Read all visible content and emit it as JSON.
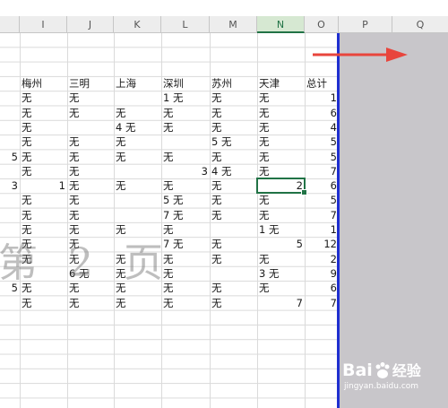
{
  "columns": [
    {
      "label": "I",
      "selected": false
    },
    {
      "label": "J",
      "selected": false
    },
    {
      "label": "K",
      "selected": false
    },
    {
      "label": "L",
      "selected": false
    },
    {
      "label": "M",
      "selected": false
    },
    {
      "label": "N",
      "selected": true
    },
    {
      "label": "O",
      "selected": false
    },
    {
      "label": "P",
      "selected": false
    },
    {
      "label": "Q",
      "selected": false
    }
  ],
  "headers": [
    "梅州",
    "三明",
    "上海",
    "深圳",
    "苏州",
    "天津",
    "总计"
  ],
  "rows": [
    {
      "lead": "",
      "cells": [
        "无",
        "无",
        "",
        "1 无",
        "无",
        "无",
        "1"
      ]
    },
    {
      "lead": "",
      "cells": [
        "无",
        "无",
        "无",
        "无",
        "无",
        "无",
        "6"
      ]
    },
    {
      "lead": "",
      "cells": [
        "无",
        "",
        "4 无",
        "无",
        "无",
        "无",
        "4"
      ]
    },
    {
      "lead": "",
      "cells": [
        "无",
        "无",
        "无",
        "",
        "5 无",
        "无",
        "5"
      ]
    },
    {
      "lead": "5",
      "cells": [
        "无",
        "无",
        "无",
        "无",
        "无",
        "无",
        "5"
      ]
    },
    {
      "lead": "",
      "cells": [
        "无",
        "无",
        "",
        "3",
        "4 无",
        "无",
        "7"
      ]
    },
    {
      "lead": "3",
      "cells": [
        "1",
        "无",
        "无",
        "无",
        "无",
        "2",
        "6"
      ]
    },
    {
      "lead": "",
      "cells": [
        "无",
        "无",
        "",
        "5 无",
        "无",
        "无",
        "5"
      ]
    },
    {
      "lead": "",
      "cells": [
        "无",
        "无",
        "",
        "7 无",
        "无",
        "无",
        "7"
      ]
    },
    {
      "lead": "",
      "cells": [
        "无",
        "无",
        "无",
        "无",
        "",
        "1 无",
        "1"
      ]
    },
    {
      "lead": "",
      "cells": [
        "无",
        "无",
        "",
        "7 无",
        "无",
        "5",
        "12"
      ]
    },
    {
      "lead": "",
      "cells": [
        "无",
        "无",
        "无",
        "无",
        "无",
        "无",
        "2"
      ]
    },
    {
      "lead": "",
      "cells": [
        "",
        "6 无",
        "无",
        "无",
        "",
        "3 无",
        "9"
      ]
    },
    {
      "lead": "5",
      "cells": [
        "无",
        "无",
        "无",
        "无",
        "无",
        "无",
        "6"
      ]
    },
    {
      "lead": "",
      "cells": [
        "无",
        "无",
        "无",
        "无",
        "无",
        "7",
        "7"
      ]
    }
  ],
  "watermark_text": "第 2 页",
  "brand": {
    "name": "Bai",
    "name2": "经验",
    "url": "jingyan.baidu.com"
  },
  "colors": {
    "accent": "#217346",
    "page_break": "#1f2fd0",
    "arrow": "#e8453c",
    "gray_area": "#c8c6ca"
  }
}
